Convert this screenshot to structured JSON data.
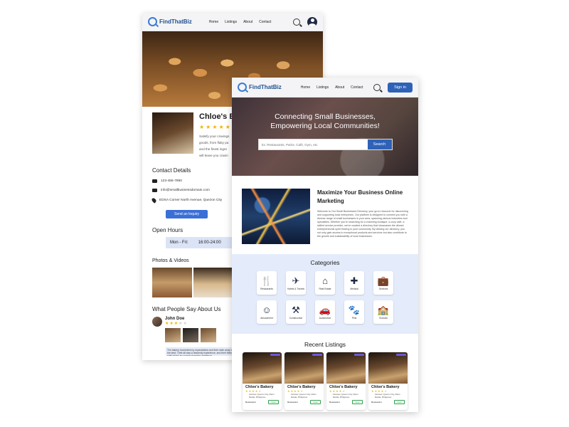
{
  "brand": {
    "name": "FindThatBiz",
    "accent": "#2f62b7",
    "dark_navy": "#1f2a44",
    "category_bg": "#e4ecfb"
  },
  "back_page": {
    "nav": {
      "links": [
        "Home",
        "Listings",
        "About",
        "Contact"
      ],
      "search_icon": "search-icon",
      "account_icon": "user-circle-icon"
    },
    "business": {
      "name": "Chloe's Ba",
      "rating": 5,
      "description": [
        "Satisfy your cravings",
        "goods, from flaky pa",
        "and the finest ingre",
        "will leave you cravin"
      ]
    },
    "contact": {
      "title": "Contact Details",
      "phone": "123-456-7890",
      "email": "info@smallbusinessdomain.com",
      "address": "EDSA Corner North Avenue, Quezon City",
      "inquiry_label": "Send an Inquiry"
    },
    "hours": {
      "title": "Open Hours",
      "days": "Mon - Fri:",
      "time": "16:00-24:00"
    },
    "photos_title": "Photos & Videos",
    "reviews": {
      "title": "What People Say About Us",
      "reviewer": "John Doe",
      "rating": 3,
      "text": "The bakery exceeded my expectations and their wide array of the best. Their all was a heavenly experience, and their friendly staff added an overall charming ambience."
    }
  },
  "front_page": {
    "nav": {
      "links": [
        "Home",
        "Listings",
        "About",
        "Contact"
      ],
      "search_icon": "search-icon",
      "signin_label": "Sign in"
    },
    "hero": {
      "title_line1": "Connecting Small Businesses,",
      "title_line2": "Empowering Local Communities!",
      "search_placeholder": "Ex: Restaurants, Parlor, Café, Gym, etc.",
      "search_button": "Search"
    },
    "marketing": {
      "title": "Maximize Your Business Online Marketing",
      "body": "Welcome to Our Small Businesses Directory, your go-to resource for discovering and supporting local enterprises. Our platform is designed to connect you with a diverse range of small businesses in your area, spanning various industries and specialties. Whether you're searching for a charming boutique, a cozy café, a skilled service provider, we've curated a directory that showcases the vibrant entrepreneurial spirit thriving in your community. By utilizing our directory, you not only gain access to exceptional products and services but also contribute to the growth and sustainability of local businesses."
    },
    "categories": {
      "title": "Categories",
      "items": [
        {
          "label": "Restaurants",
          "icon": "utensils-icon",
          "glyph": "🍴"
        },
        {
          "label": "Hotels & Travels",
          "icon": "plane-icon",
          "glyph": "✈"
        },
        {
          "label": "Real Estate",
          "icon": "building-sign-icon",
          "glyph": "⌂"
        },
        {
          "label": "Medical",
          "icon": "medical-cross-icon",
          "glyph": "✚"
        },
        {
          "label": "Services",
          "icon": "briefcase-icon",
          "glyph": "💼"
        },
        {
          "label": "Amusement",
          "icon": "theater-mask-icon",
          "glyph": "☺"
        },
        {
          "label": "Construction",
          "icon": "tools-icon",
          "glyph": "⚒"
        },
        {
          "label": "Automotive",
          "icon": "car-icon",
          "glyph": "🚗"
        },
        {
          "label": "Pets",
          "icon": "paw-icon",
          "glyph": "🐾"
        },
        {
          "label": "Schools",
          "icon": "school-icon",
          "glyph": "🏫"
        }
      ]
    },
    "recent": {
      "title": "Recent Listings",
      "items": [
        {
          "name": "Chloe's Bakery",
          "rating": 4,
          "location": "Fairview, Quezon City, Metro Manila, Philippines",
          "category": "Restaurant",
          "status": "Open"
        },
        {
          "name": "Chloe's Bakery",
          "rating": 4,
          "location": "Fairview, Quezon City, Metro Manila, Philippines",
          "category": "Restaurant",
          "status": "Open"
        },
        {
          "name": "Chloe's Bakery",
          "rating": 4,
          "location": "Fairview, Quezon City, Metro Manila, Philippines",
          "category": "Restaurant",
          "status": "Open"
        },
        {
          "name": "Chloe's Bakery",
          "rating": 4,
          "location": "Fairview, Quezon City, Metro Manila, Philippines",
          "category": "Restaurant",
          "status": "Open"
        }
      ]
    }
  }
}
